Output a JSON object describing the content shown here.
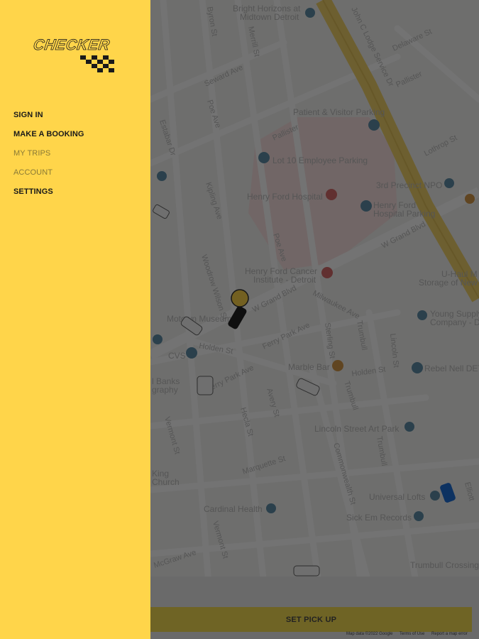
{
  "drawer": {
    "logo_text": "CHECKER",
    "menu": [
      {
        "label": "SIGN IN",
        "enabled": true
      },
      {
        "label": "MAKE A BOOKING",
        "enabled": true
      },
      {
        "label": "MY TRIPS",
        "enabled": false
      },
      {
        "label": "ACCOUNT",
        "enabled": false
      },
      {
        "label": "SETTINGS",
        "enabled": true
      }
    ]
  },
  "map": {
    "pois": [
      "Bright Horizons at",
      "Midtown Detroit",
      "Patient & Visitor Parking",
      "Lot 10 Employee Parking",
      "Henry Ford Hospital",
      "3rd Precinct NPO",
      "Henry Ford",
      "Hospital Parking",
      "Henry Ford Cancer",
      "Institute - Detroit",
      "Motown Museum",
      "CVS",
      "Marble Bar",
      "Young Supply",
      "Company - D",
      "Rebel Nell DET",
      "U-Haul M",
      "Storage of New",
      "Lincoln Street Art Park",
      "Universal Lofts",
      "Sick Em Records",
      "Cardinal Health",
      "Trumbull Crossing",
      "l Banks",
      "graphy",
      "King",
      "Church"
    ],
    "streets": [
      "Byron St",
      "Seward Ave",
      "Merrill St",
      "Pallister",
      "Delaware St",
      "John C Lodge Service Dr",
      "Lothrop St",
      "Poe Ave",
      "Kipling Ave",
      "W Grand Blvd",
      "Milwaukee Ave",
      "Ferry Park Ave",
      "Holden St",
      "Lincoln St",
      "Trumbull St",
      "Sterling St",
      "Woodrow Wilson St",
      "Avery St",
      "Hecla St",
      "Marquette St",
      "Commonwealth St",
      "Vermont St",
      "McGraw Ave",
      "Estabar Dr",
      "Dd",
      "3rd Ave",
      "Elliott St",
      "Pine St",
      "Blaine St"
    ]
  },
  "pickup_button": "SET PICK UP",
  "attribution": [
    "Map data ©2022 Google",
    "Terms of Use",
    "Report a map error"
  ],
  "colors": {
    "accent": "#ffd54a",
    "text_dark": "#1a1a1a",
    "button_dimmed": "#6f6425"
  }
}
